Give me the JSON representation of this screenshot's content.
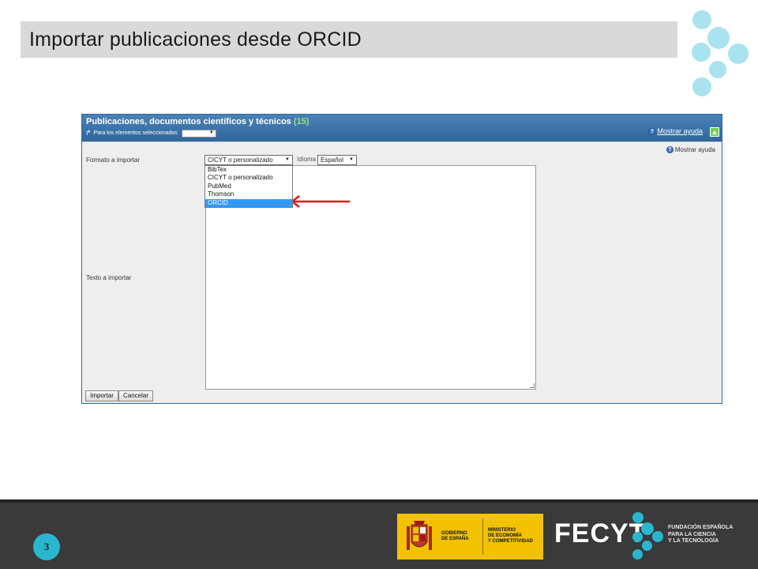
{
  "slide": {
    "title": "Importar publicaciones desde ORCID",
    "page_number": "3"
  },
  "panel": {
    "title": "Publicaciones, documentos científicos y técnicos",
    "count": "(15)",
    "selected_label": "Para los elementos seleccionados",
    "help_top": "Mostrar ayuda",
    "help_body": "Mostrar ayuda"
  },
  "form": {
    "format_label": "Formato a importar",
    "format_value": "CICYT o personalizado",
    "language_label": "Idioma",
    "language_value": "Español",
    "format_options": [
      "BibTex",
      "CICYT o personalizado",
      "PubMed",
      "Thomson",
      "ORCID"
    ],
    "highlighted_option": "ORCID",
    "text_label": "Texto a importar",
    "import_button": "Importar",
    "cancel_button": "Cancelar"
  },
  "footer": {
    "gov_line1": "GOBIERNO\nDE ESPAÑA",
    "gov_line2": "MINISTERIO\nDE ECONOMÍA\nY COMPETITIVIDAD",
    "fecyt_logo": "FECYT",
    "fecyt_sub": "FUNDACIÓN ESPAÑOLA\nPARA LA CIENCIA\nY LA TECNOLOGÍA"
  },
  "colors": {
    "accent": "#29b6cf",
    "panel_header": "#2f679d",
    "highlight": "#3399ff",
    "arrow": "#e8141b",
    "gov_yellow": "#f2c200"
  }
}
